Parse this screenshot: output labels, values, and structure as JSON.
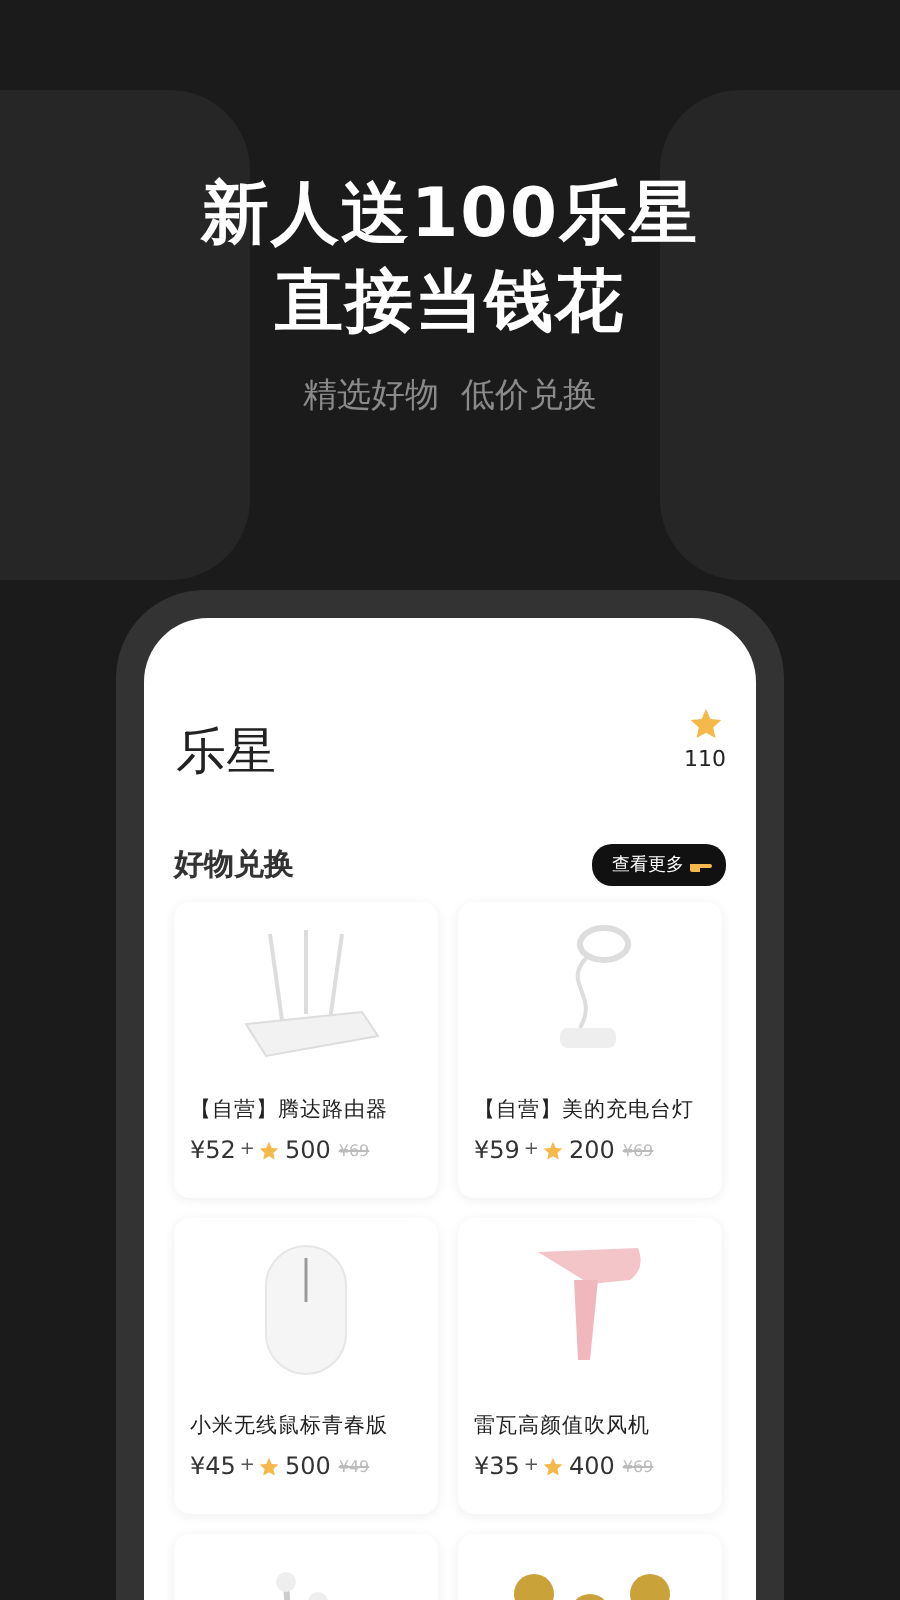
{
  "headline": [
    "新人送100乐星",
    "直接当钱花"
  ],
  "subtitle": "精选好物  低价兑换",
  "app": {
    "title": "乐星",
    "points": "110"
  },
  "section": {
    "title": "好物兑换",
    "more_button": "查看更多"
  },
  "products": [
    {
      "kind": "router",
      "name": "【自营】腾达路由器",
      "price": "¥52",
      "plus": "+",
      "points": "500",
      "original_price": "¥69"
    },
    {
      "kind": "lamp",
      "name": "【自营】美的充电台灯",
      "price": "¥59",
      "plus": "+",
      "points": "200",
      "original_price": "¥69"
    },
    {
      "kind": "mouse",
      "name": "小米无线鼠标青春版",
      "price": "¥45",
      "plus": "+",
      "points": "500",
      "original_price": "¥49"
    },
    {
      "kind": "dryer",
      "name": "雷瓦高颜值吹风机",
      "price": "¥35",
      "plus": "+",
      "points": "400",
      "original_price": "¥69"
    },
    {
      "kind": "earphones"
    },
    {
      "kind": "giftbox"
    }
  ]
}
